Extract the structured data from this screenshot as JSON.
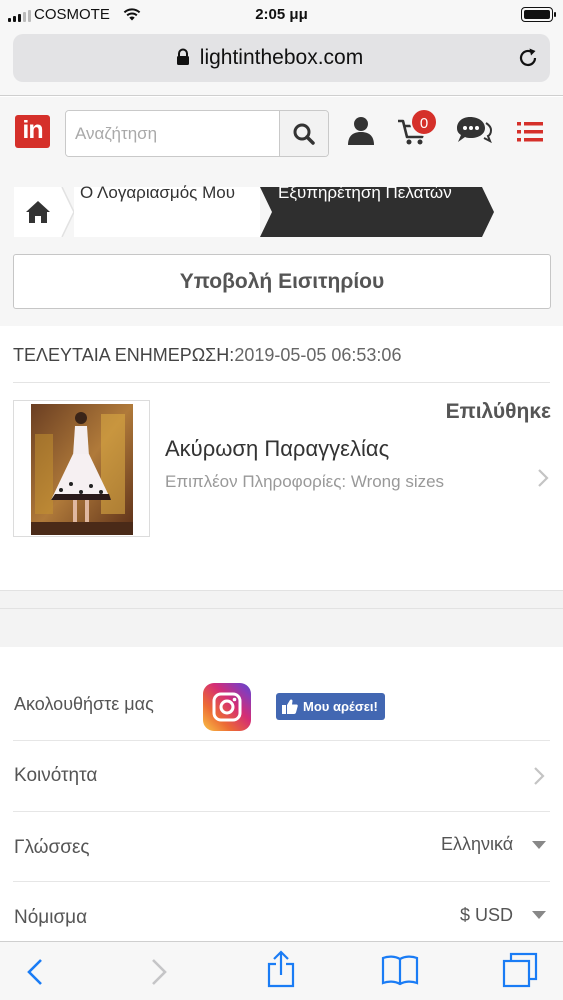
{
  "status_bar": {
    "carrier": "COSMOTE",
    "time": "2:05 μμ",
    "icons": [
      "signal-icon",
      "wifi-icon",
      "battery-icon"
    ]
  },
  "browser": {
    "url": "lightinthebox.com",
    "icons": [
      "lock-icon",
      "reload-icon"
    ]
  },
  "header": {
    "logo_text": "in",
    "search_placeholder": "Αναζήτηση",
    "cart_count": "0",
    "icons": [
      "search-icon",
      "user-icon",
      "cart-icon",
      "chat-icon",
      "menu-icon"
    ],
    "accent_color": "#d5302a"
  },
  "breadcrumb": {
    "items": [
      "Ο Λογαριασμός Μου",
      "Εξυπηρέτηση Πελατών"
    ]
  },
  "submit_button_label": "Υποβολή Εισιτηρίου",
  "ticket": {
    "last_update_label": "ΤΕΛΕΥΤΑΙΑ ΕΝΗΜΕΡΩΣΗ:",
    "last_update_value": "2019-05-05 06:53:06",
    "status": "Επιλύθηκε",
    "reason": "Ακύρωση Παραγγελίας",
    "extra_info": "Επιπλέον Πληροφορίες: Wrong sizes"
  },
  "footer": {
    "follow_label": "Ακολουθήστε μας",
    "fb_like_label": "Μου αρέσει!",
    "community_label": "Κοινότητα",
    "languages_label": "Γλώσσες",
    "languages_value": "Ελληνικά",
    "currency_label": "Νόμισμα",
    "currency_value": "$ USD"
  },
  "toolbar": {
    "icons": [
      "back-icon",
      "forward-icon",
      "share-icon",
      "bookmarks-icon",
      "tabs-icon"
    ],
    "tint_color": "#1a7cf5"
  }
}
